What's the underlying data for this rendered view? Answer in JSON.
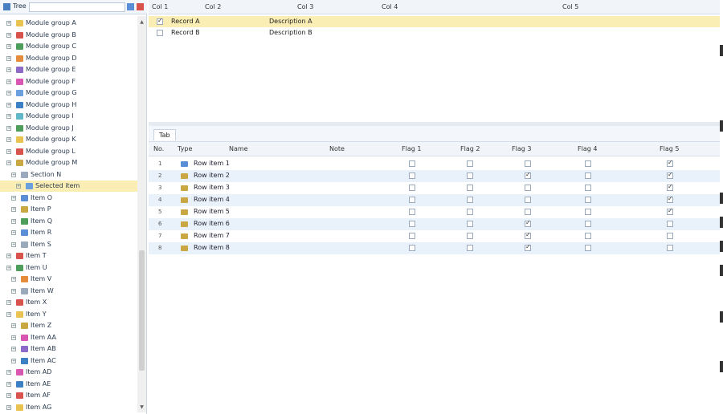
{
  "sidebar": {
    "title": "Tree",
    "search_placeholder": "",
    "nodes": [
      {
        "label": "Module group A",
        "color": "#e9c24f",
        "level": 1
      },
      {
        "label": "Module group B",
        "color": "#d8534c",
        "level": 1
      },
      {
        "label": "Module group C",
        "color": "#4d9e5a",
        "level": 1
      },
      {
        "label": "Module group D",
        "color": "#e58c3c",
        "level": 1
      },
      {
        "label": "Module group E",
        "color": "#8d6ac8",
        "level": 1
      },
      {
        "label": "Module group F",
        "color": "#d957b3",
        "level": 1
      },
      {
        "label": "Module group G",
        "color": "#6aa0dd",
        "level": 1
      },
      {
        "label": "Module group H",
        "color": "#3b7fc4",
        "level": 1
      },
      {
        "label": "Module group I",
        "color": "#5fb7c9",
        "level": 1
      },
      {
        "label": "Module group J",
        "color": "#4d9e5a",
        "level": 1
      },
      {
        "label": "Module group K",
        "color": "#e9c24f",
        "level": 1
      },
      {
        "label": "Module group L",
        "color": "#d8534c",
        "level": 1
      },
      {
        "label": "Module group M",
        "color": "#c9a844",
        "level": 1
      },
      {
        "label": "Section N",
        "color": "#9aa9bb",
        "level": 2
      },
      {
        "label": "Selected item",
        "color": "#6aa0dd",
        "level": 3,
        "selected": true
      },
      {
        "label": "Item O",
        "color": "#5a8fd8",
        "level": 2
      },
      {
        "label": "Item P",
        "color": "#c9a844",
        "level": 2
      },
      {
        "label": "Item Q",
        "color": "#4d9e5a",
        "level": 2
      },
      {
        "label": "Item R",
        "color": "#5a8fd8",
        "level": 2
      },
      {
        "label": "Item S",
        "color": "#9aa9bb",
        "level": 2
      },
      {
        "label": "Item T",
        "color": "#d8534c",
        "level": 1
      },
      {
        "label": "Item U",
        "color": "#4d9e5a",
        "level": 1
      },
      {
        "label": "Item V",
        "color": "#e58c3c",
        "level": 2
      },
      {
        "label": "Item W",
        "color": "#9aa9bb",
        "level": 2
      },
      {
        "label": "Item X",
        "color": "#d8534c",
        "level": 1
      },
      {
        "label": "Item Y",
        "color": "#e9c24f",
        "level": 1
      },
      {
        "label": "Item Z",
        "color": "#c9a844",
        "level": 2
      },
      {
        "label": "Item AA",
        "color": "#d957b3",
        "level": 2
      },
      {
        "label": "Item AB",
        "color": "#8d6ac8",
        "level": 2
      },
      {
        "label": "Item AC",
        "color": "#3b7fc4",
        "level": 2
      },
      {
        "label": "Item AD",
        "color": "#d957b3",
        "level": 1
      },
      {
        "label": "Item AE",
        "color": "#3b7fc4",
        "level": 1
      },
      {
        "label": "Item AF",
        "color": "#d8534c",
        "level": 1
      },
      {
        "label": "Item AG",
        "color": "#e9c24f",
        "level": 1
      }
    ]
  },
  "top_grid": {
    "headers": [
      "Col 1",
      "Col 2",
      "Col 3",
      "Col 4",
      "Col 5"
    ],
    "rows": [
      {
        "name": "Record A",
        "desc": "Description A",
        "checked": true,
        "highlight": true
      },
      {
        "name": "Record B",
        "desc": "Description B",
        "checked": false,
        "highlight": false
      }
    ]
  },
  "bottom": {
    "tab_label": "Tab",
    "headers": [
      "No.",
      "Type",
      "Name",
      "Note",
      "Flag 1",
      "Flag 2",
      "Flag 3",
      "Flag 4",
      "Flag 5"
    ],
    "rows": [
      {
        "no": "1",
        "name": "Row item 1",
        "flags": [
          false,
          false,
          false,
          false,
          true
        ],
        "folder": "blue"
      },
      {
        "no": "2",
        "name": "Row item 2",
        "flags": [
          false,
          false,
          true,
          false,
          true
        ],
        "folder": "gold"
      },
      {
        "no": "3",
        "name": "Row item 3",
        "flags": [
          false,
          false,
          false,
          false,
          true
        ],
        "folder": "gold"
      },
      {
        "no": "4",
        "name": "Row item 4",
        "flags": [
          false,
          false,
          false,
          false,
          true
        ],
        "folder": "gold"
      },
      {
        "no": "5",
        "name": "Row item 5",
        "flags": [
          false,
          false,
          false,
          false,
          true
        ],
        "folder": "gold"
      },
      {
        "no": "6",
        "name": "Row item 6",
        "flags": [
          false,
          false,
          true,
          false,
          false
        ],
        "folder": "gold"
      },
      {
        "no": "7",
        "name": "Row item 7",
        "flags": [
          false,
          false,
          true,
          false,
          false
        ],
        "folder": "gold"
      },
      {
        "no": "8",
        "name": "Row item 8",
        "flags": [
          false,
          false,
          true,
          false,
          false
        ],
        "folder": "gold"
      }
    ]
  },
  "colors": {
    "selection": "#fbeeb4",
    "row_alt": "#e9f1fb",
    "border": "#c9d6e6"
  }
}
